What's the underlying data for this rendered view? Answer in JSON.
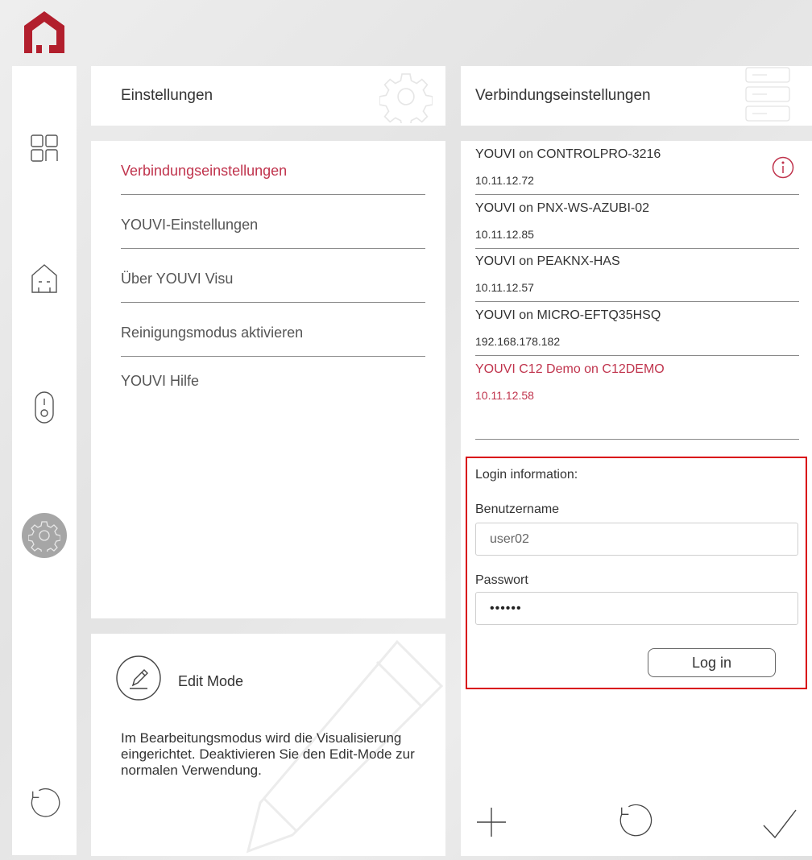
{
  "app": {
    "logo_icon": "house-logo-icon",
    "brand_color": "#b21f2d",
    "accent_color": "#c0344d"
  },
  "sidebar": {
    "icons": [
      "dashboard-grid-icon",
      "home-rooms-icon",
      "device-switch-icon",
      "settings-gear-icon",
      "refresh-icon"
    ],
    "active": "settings-gear-icon"
  },
  "settings": {
    "header_title": "Einstellungen",
    "menu": [
      {
        "label": "Verbindungseinstellungen",
        "active": true
      },
      {
        "label": "YOUVI-Einstellungen",
        "active": false
      },
      {
        "label": "Über YOUVI Visu",
        "active": false
      },
      {
        "label": "Reinigungsmodus aktivieren",
        "active": false
      },
      {
        "label": "YOUVI Hilfe",
        "active": false
      }
    ]
  },
  "edit_mode": {
    "title": "Edit Mode",
    "description": "Im Bearbeitungsmodus wird die Visualisierung eingerichtet. Deaktivieren Sie den Edit-Mode zur normalen Verwendung."
  },
  "connection": {
    "header_title": "Verbindungseinstellungen",
    "servers": [
      {
        "name": "YOUVI on CONTROLPRO-3216",
        "ip": "10.11.12.72",
        "active": false
      },
      {
        "name": "YOUVI on PNX-WS-AZUBI-02",
        "ip": "10.11.12.85",
        "active": false
      },
      {
        "name": "YOUVI on PEAKNX-HAS",
        "ip": "10.11.12.57",
        "active": false
      },
      {
        "name": "YOUVI on MICRO-EFTQ35HSQ",
        "ip": "192.168.178.182",
        "active": false
      },
      {
        "name": "YOUVI C12 Demo on C12DEMO",
        "ip": "10.11.12.58",
        "active": true
      }
    ],
    "login": {
      "heading": "Login information:",
      "username_label": "Benutzername",
      "username_value": "user02",
      "password_label": "Passwort",
      "password_value": "••••••",
      "button_label": "Log in"
    },
    "actions": [
      "add-icon",
      "refresh-icon",
      "checkmark-icon"
    ]
  }
}
